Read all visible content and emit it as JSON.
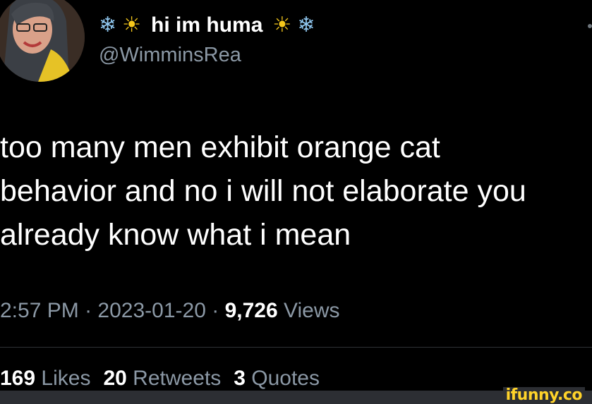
{
  "author": {
    "display_name": "hi im huma",
    "handle": "@WimminsRea",
    "name_emoji_left": [
      "❄",
      "☀"
    ],
    "name_emoji_right": [
      "☀",
      "❄"
    ]
  },
  "tweet": {
    "text_lines": [
      "too many men exhibit orange cat",
      "behavior and no i will not elaborate you",
      "already know what i mean"
    ]
  },
  "meta": {
    "time": "2:57 PM",
    "separator": "·",
    "date": "2023-01-20",
    "views_count": "9,726",
    "views_label": "Views"
  },
  "stats": {
    "likes_count": "169",
    "likes_label": "Likes",
    "retweets_count": "20",
    "retweets_label": "Retweets",
    "quotes_count": "3",
    "quotes_label": "Quotes"
  },
  "watermark": "ifunny.co",
  "colors": {
    "background": "#000000",
    "text": "#ffffff",
    "secondary_text": "#8b98a5",
    "watermark": "#ffd32a"
  },
  "icons": [
    "snowflake-icon",
    "sun-icon",
    "more-icon"
  ]
}
